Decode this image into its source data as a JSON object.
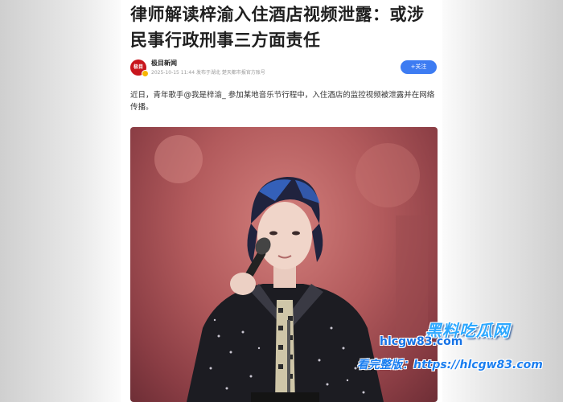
{
  "article": {
    "title": "律师解读梓渝入住酒店视频泄露：或涉民事行政刑事三方面责任",
    "author": {
      "name": "极目新闻",
      "avatar_text": "极目",
      "meta": "2025-10-15 11:44 发布于湖北 楚天都市报官方账号"
    },
    "follow_label": "+关注",
    "lead": "近日，青年歌手@我是梓渝_ 参加某地音乐节行程中，入住酒店的监控视频被泄露并在网络传播。",
    "image": {
      "subject": "performer-on-stage",
      "colors": {
        "background": "#b25a5c",
        "jacket": "#1c1c22",
        "hair": "#2a2f5c"
      }
    }
  },
  "watermark": {
    "brand": "黑料吃瓜网",
    "url": "hlcgw83.com",
    "full_text": "看完整版：https://hlcgw83.com"
  },
  "colors": {
    "accent": "#3d7cf2",
    "title": "#1f1f1f"
  }
}
